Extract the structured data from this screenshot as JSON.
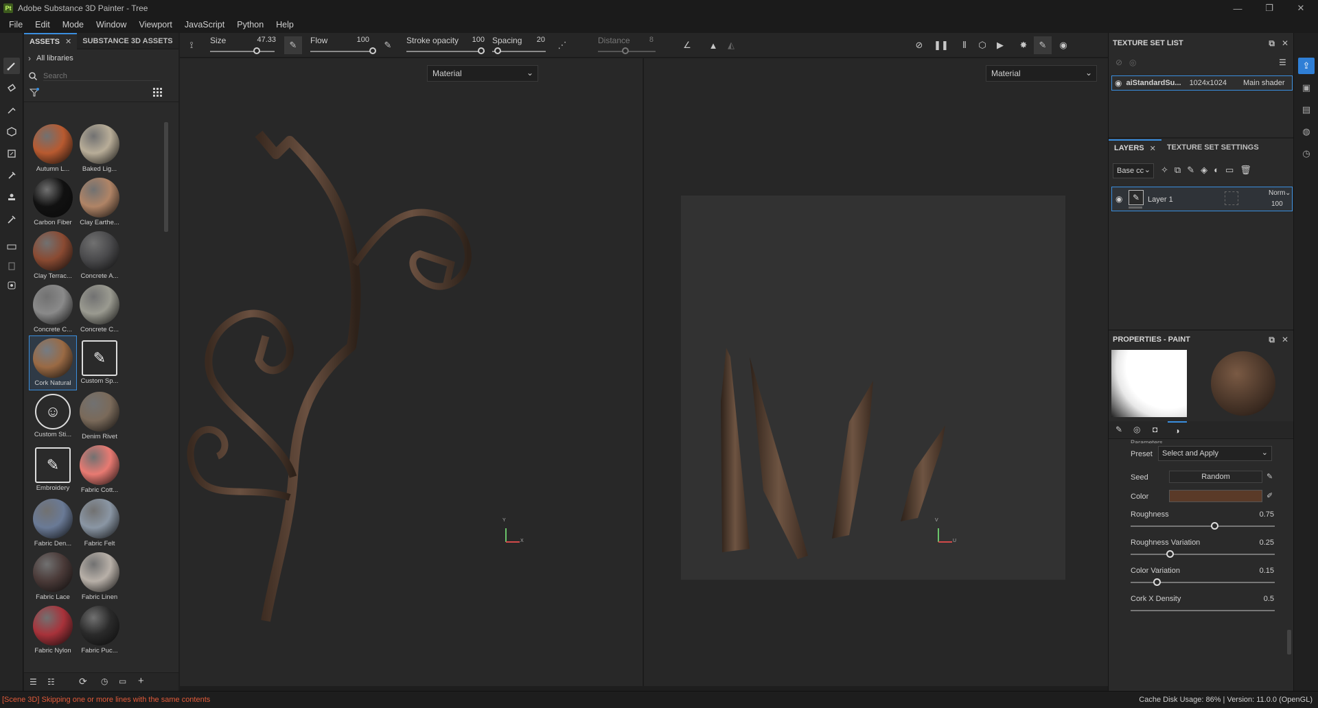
{
  "window": {
    "app_icon": "Pt",
    "title": "Adobe Substance 3D Painter - Tree",
    "controls": [
      "—",
      "❐",
      "✕"
    ]
  },
  "menu": [
    "File",
    "Edit",
    "Mode",
    "Window",
    "Viewport",
    "JavaScript",
    "Python",
    "Help"
  ],
  "assets": {
    "tab_assets": "ASSETS",
    "tab_substance": "SUBSTANCE 3D ASSETS",
    "breadcrumb": "All libraries",
    "search_placeholder": "Search",
    "items": [
      {
        "label": "Autumn L...",
        "color": "#b85a30"
      },
      {
        "label": "Baked Lig...",
        "color": "#b8ad98"
      },
      {
        "label": "Carbon Fiber",
        "color": "#111111"
      },
      {
        "label": "Clay Earthe...",
        "color": "#b08466"
      },
      {
        "label": "Clay Terrac...",
        "color": "#8a4a32"
      },
      {
        "label": "Concrete A...",
        "color": "#4a4a4c"
      },
      {
        "label": "Concrete C...",
        "color": "#8a8a8a"
      },
      {
        "label": "Concrete C...",
        "color": "#9a9a90"
      },
      {
        "label": "Cork Natural",
        "color": "#9a6a44"
      },
      {
        "label": "Custom Sp...",
        "color": "#e8e8e8"
      },
      {
        "label": "Custom Sti...",
        "color": "#e8e8e8"
      },
      {
        "label": "Denim Rivet",
        "color": "#7a6a5a"
      },
      {
        "label": "Embroidery",
        "color": "#e8e8e8"
      },
      {
        "label": "Fabric Cott...",
        "color": "#e87a72"
      },
      {
        "label": "Fabric Den...",
        "color": "#6a7a96"
      },
      {
        "label": "Fabric Felt",
        "color": "#8a96a4"
      },
      {
        "label": "Fabric Lace",
        "color": "#4a3a38"
      },
      {
        "label": "Fabric Linen",
        "color": "#b8b0a8"
      },
      {
        "label": "Fabric Nylon",
        "color": "#a8323a"
      },
      {
        "label": "Fabric Puc...",
        "color": "#2a2a2a"
      }
    ]
  },
  "tool_options": {
    "size_label": "Size",
    "size_value": "47.33",
    "flow_label": "Flow",
    "flow_value": "100",
    "stroke_opacity_label": "Stroke opacity",
    "stroke_opacity_value": "100",
    "spacing_label": "Spacing",
    "spacing_value": "20",
    "distance_label": "Distance",
    "distance_value": "8"
  },
  "viewports": {
    "left_mode": "Material",
    "right_mode": "Material",
    "axis_y": "Y",
    "axis_x": "X",
    "axis_v": "V",
    "axis_u": "U"
  },
  "texture_set_list": {
    "title": "TEXTURE SET LIST",
    "item_name": "aiStandardSu...",
    "item_res": "1024x1024",
    "item_shader": "Main shader"
  },
  "layers": {
    "tab_layers": "LAYERS",
    "tab_settings": "TEXTURE SET SETTINGS",
    "channel": "Base cc",
    "layer_name": "Layer 1",
    "blend_mode": "Norm",
    "opacity": "100"
  },
  "properties": {
    "title": "PROPERTIES - PAINT",
    "section": "Parameters",
    "preset_label": "Preset",
    "preset_value": "Select and Apply",
    "seed_label": "Seed",
    "seed_value": "Random",
    "color_label": "Color",
    "color_swatch": "#5a3a28",
    "roughness_label": "Roughness",
    "roughness_value": "0.75",
    "roughness_variation_label": "Roughness Variation",
    "roughness_variation_value": "0.25",
    "color_variation_label": "Color Variation",
    "color_variation_value": "0.15",
    "cork_x_label": "Cork X Density",
    "cork_x_value": "0.5"
  },
  "status": {
    "message": "[Scene 3D] Skipping one or more lines with the same contents",
    "right": "Cache Disk Usage:    86% | Version: 11.0.0 (OpenGL)"
  },
  "colors": {
    "accent": "#3a8fe0",
    "status_error": "#e25b3a"
  }
}
